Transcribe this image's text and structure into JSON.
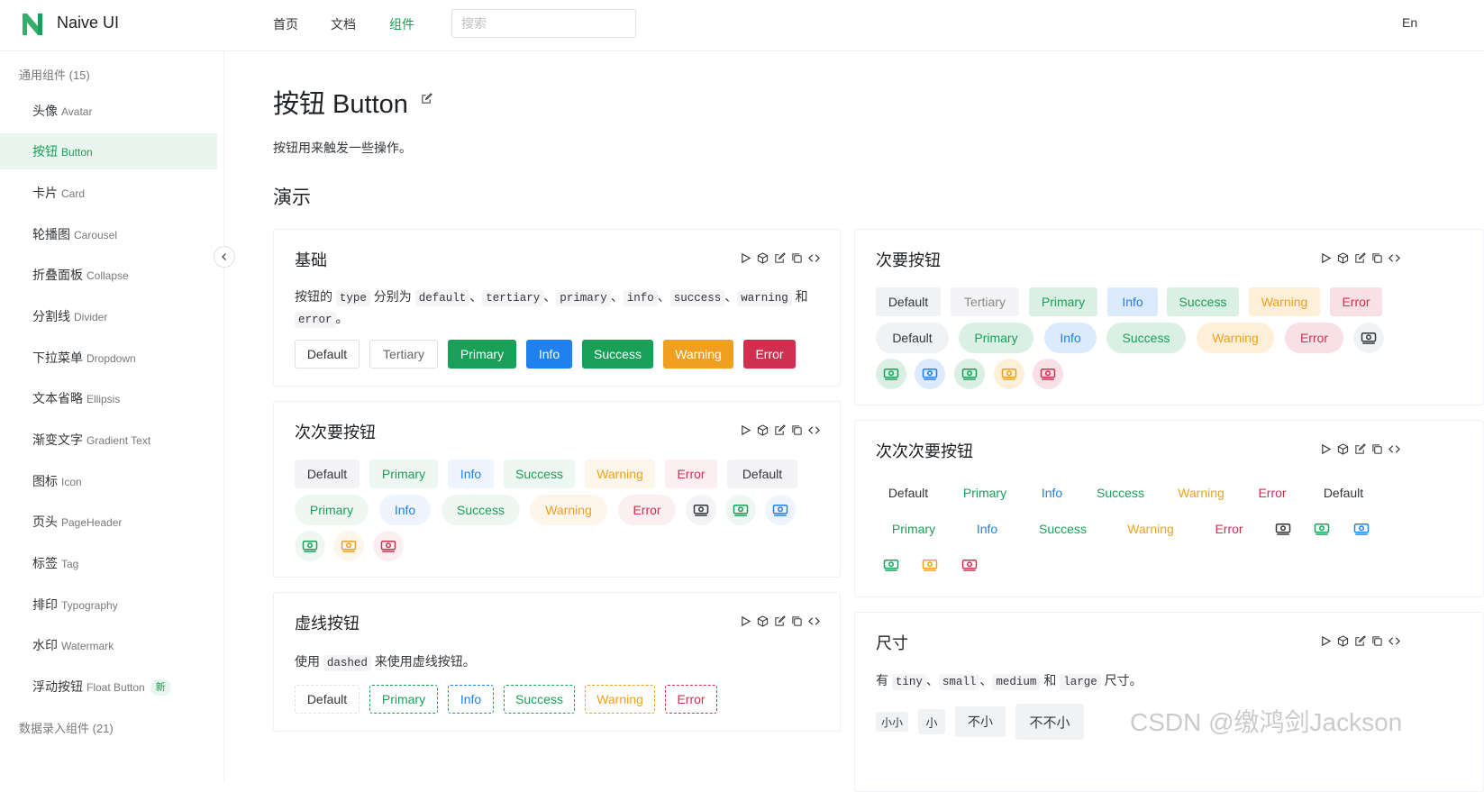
{
  "header": {
    "brand": "Naive UI",
    "nav": [
      "首页",
      "文档",
      "组件"
    ],
    "search_placeholder": "搜索",
    "lang": "En",
    "accent_color": "#18a058"
  },
  "sidebar": {
    "group1": "通用组件 (15)",
    "items": [
      {
        "cn": "头像",
        "en": "Avatar"
      },
      {
        "cn": "按钮",
        "en": "Button"
      },
      {
        "cn": "卡片",
        "en": "Card"
      },
      {
        "cn": "轮播图",
        "en": "Carousel"
      },
      {
        "cn": "折叠面板",
        "en": "Collapse"
      },
      {
        "cn": "分割线",
        "en": "Divider"
      },
      {
        "cn": "下拉菜单",
        "en": "Dropdown"
      },
      {
        "cn": "文本省略",
        "en": "Ellipsis"
      },
      {
        "cn": "渐变文字",
        "en": "Gradient Text"
      },
      {
        "cn": "图标",
        "en": "Icon"
      },
      {
        "cn": "页头",
        "en": "PageHeader"
      },
      {
        "cn": "标签",
        "en": "Tag"
      },
      {
        "cn": "排印",
        "en": "Typography"
      },
      {
        "cn": "水印",
        "en": "Watermark"
      },
      {
        "cn": "浮动按钮",
        "en": "Float Button",
        "badge": "新"
      }
    ],
    "group2": "数据录入组件 (21)"
  },
  "main": {
    "title": "按钮 Button",
    "intro": "按钮用来触发一些操作。",
    "demo_heading": "演示",
    "labels": {
      "default": "Default",
      "tertiary": "Tertiary",
      "primary": "Primary",
      "info": "Info",
      "success": "Success",
      "warning": "Warning",
      "error": "Error"
    },
    "basic": {
      "title": "基础",
      "desc": {
        "t1": "按钮的",
        "c_type": "type",
        "t2": "分别为",
        "c_default": "default",
        "sep": "、",
        "c_tertiary": "tertiary",
        "c_primary": "primary",
        "c_info": "info",
        "c_success": "success",
        "c_warning": "warning",
        "and": "和",
        "c_error": "error",
        "end": "。"
      }
    },
    "secondary": {
      "title": "次要按钮"
    },
    "tertiary_card": {
      "title": "次次要按钮"
    },
    "quaternary": {
      "title": "次次次要按钮"
    },
    "dashed": {
      "title": "虚线按钮",
      "desc": {
        "t1": "使用",
        "code": "dashed",
        "t2": "来使用虚线按钮。"
      }
    },
    "size": {
      "title": "尺寸",
      "desc": {
        "t1": "有",
        "c_tiny": "tiny",
        "sep": "、",
        "c_small": "small",
        "c_medium": "medium",
        "and": "和",
        "c_large": "large",
        "t2": "尺寸。"
      },
      "buttons": [
        "小小",
        "小",
        "不小",
        "不不小"
      ]
    }
  },
  "watermark": "CSDN @缴鸿剑Jackson"
}
